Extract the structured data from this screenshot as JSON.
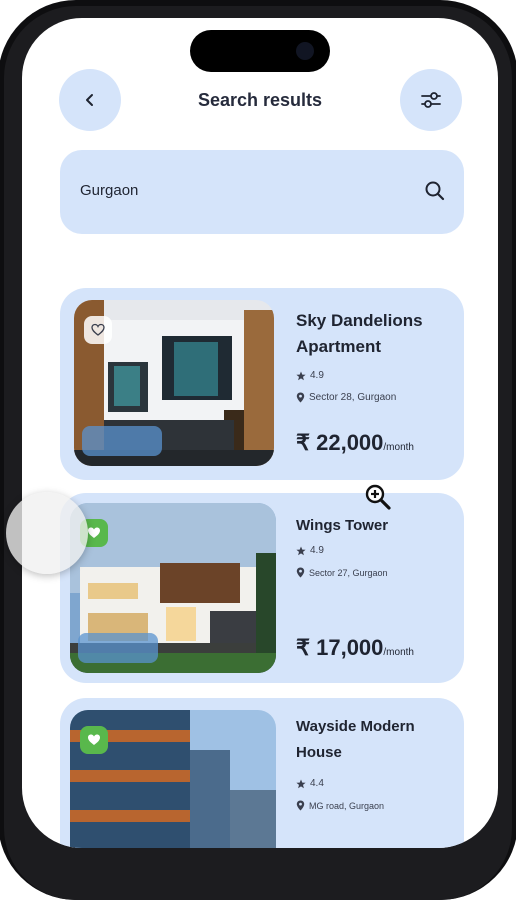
{
  "header": {
    "title": "Search results"
  },
  "search": {
    "value": "Gurgaon"
  },
  "icons": {
    "back": "chevron-left-icon",
    "filter": "sliders-icon",
    "search": "search-icon",
    "favorite": "heart-icon",
    "rating": "star-icon",
    "location": "pin-icon"
  },
  "colors": {
    "card_bg": "#d5e4fa",
    "text": "#1f2431",
    "favorite_active": "#59b84c"
  },
  "listings": [
    {
      "name": "Sky Dandelions Apartment",
      "rating": "4.9",
      "location": "Sector 28, Gurgaon",
      "price": "₹ 22,000",
      "unit": "/month",
      "favorite": false
    },
    {
      "name": "Wings Tower",
      "rating": "4.9",
      "location": "Sector 27, Gurgaon",
      "price": "₹ 17,000",
      "unit": "/month",
      "favorite": true
    },
    {
      "name": "Wayside Modern House",
      "rating": "4.4",
      "location": "MG road, Gurgaon",
      "price": "",
      "unit": "",
      "favorite": true
    }
  ]
}
